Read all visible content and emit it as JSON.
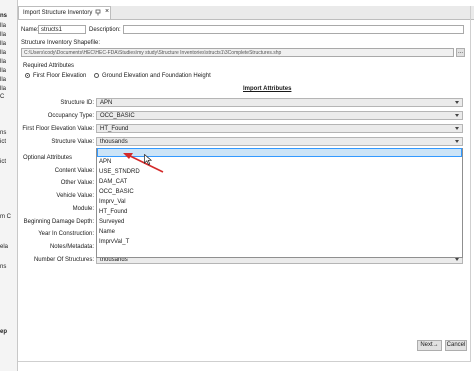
{
  "left_strip": [
    "ns",
    "lla",
    "lla",
    "lla",
    "lla",
    "lla",
    "lla",
    "lla",
    "lla",
    "C",
    "ns",
    "ict",
    "ict",
    "m C",
    "ela",
    "ns",
    "ep"
  ],
  "tab": {
    "title": "Import Structure Inventory",
    "pin_icon": "pin-icon",
    "close_label": "×"
  },
  "form": {
    "name_label": "Name:",
    "name_value": "structs1",
    "description_label": "Description:",
    "description_value": "",
    "shapefile_label": "Structure Inventory Shapefile:",
    "shapefile_path": "C:\\Users\\cody\\Documents\\HEC\\HEC-FDA\\Studies\\my study\\Structure Inventories\\structs1\\3CompleteStructures.shp",
    "browse_label": "...",
    "required_label": "Required Attributes",
    "radio_first_floor": "First Floor Elevation",
    "radio_ground": "Ground Elevation and Foundation Height",
    "import_attributes_header": "Import Attributes"
  },
  "required_rows": [
    {
      "label": "Structure ID:",
      "value": "APN"
    },
    {
      "label": "Occupancy Type:",
      "value": "OCC_BASIC"
    },
    {
      "label": "First Floor Elevation Value:",
      "value": "HT_Found"
    },
    {
      "label": "Structure Value:",
      "value": "thousands"
    }
  ],
  "optional": {
    "header": "Optional Attributes",
    "labels": [
      "Content Value:",
      "Other Value:",
      "Vehicle Value:",
      "Module:",
      "Beginning Damage Depth:",
      "Year In Construction:",
      "Notes/Metadata:",
      "Number Of Structures:"
    ],
    "number_of_structures_value": "thousands"
  },
  "dropdown": {
    "selected": "",
    "options": [
      "APN",
      "USE_STNDRD",
      "DAM_CAT",
      "OCC_BASIC",
      "Imprv_Val",
      "HT_Found",
      "Surveyed",
      "Name",
      "ImprvVal_T",
      "thousands"
    ]
  },
  "buttons": {
    "next_label": "Next→",
    "cancel_label": "Cancel"
  },
  "colors": {
    "selection": "#cce4f7",
    "annotation_arrow": "#d42a2a"
  }
}
